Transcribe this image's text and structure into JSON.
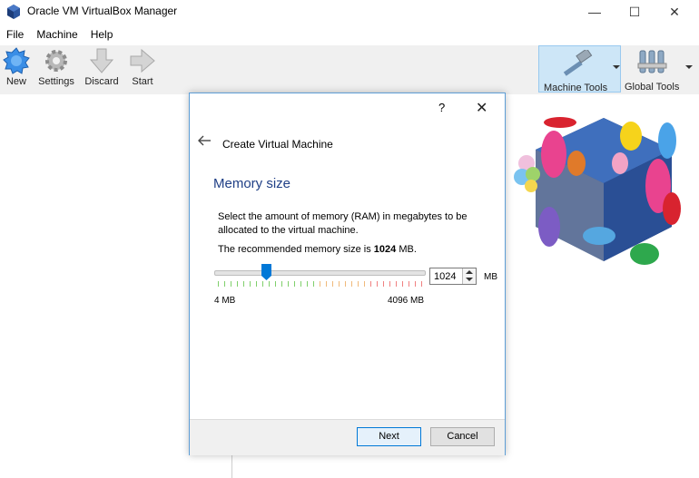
{
  "window": {
    "title": "Oracle VM VirtualBox Manager",
    "minimize": "—",
    "maximize": "☐",
    "close": "✕"
  },
  "menu": [
    "File",
    "Machine",
    "Help"
  ],
  "toolbar": {
    "new": "New",
    "settings": "Settings",
    "discard": "Discard",
    "start": "Start",
    "machine_tools": "Machine Tools",
    "global_tools": "Global Tools"
  },
  "dialog": {
    "help": "?",
    "close": "✕",
    "title": "Create Virtual Machine",
    "heading": "Memory size",
    "description": "Select the amount of memory (RAM) in megabytes to be allocated to the virtual machine.",
    "recommend_prefix": "The recommended memory size is ",
    "recommend_value": "1024",
    "recommend_suffix": " MB.",
    "slider": {
      "min_label": "4 MB",
      "max_label": "4096 MB",
      "value": 1024,
      "min": 4,
      "max": 4096
    },
    "spin_value": "1024",
    "unit": "MB",
    "next_label": "Next",
    "cancel_label": "Cancel"
  },
  "colors": {
    "accent": "#0078d7",
    "heading": "#1f3f86",
    "tick_green": "#7fcf6b",
    "tick_orange": "#f0b97a",
    "tick_red": "#f08080"
  }
}
